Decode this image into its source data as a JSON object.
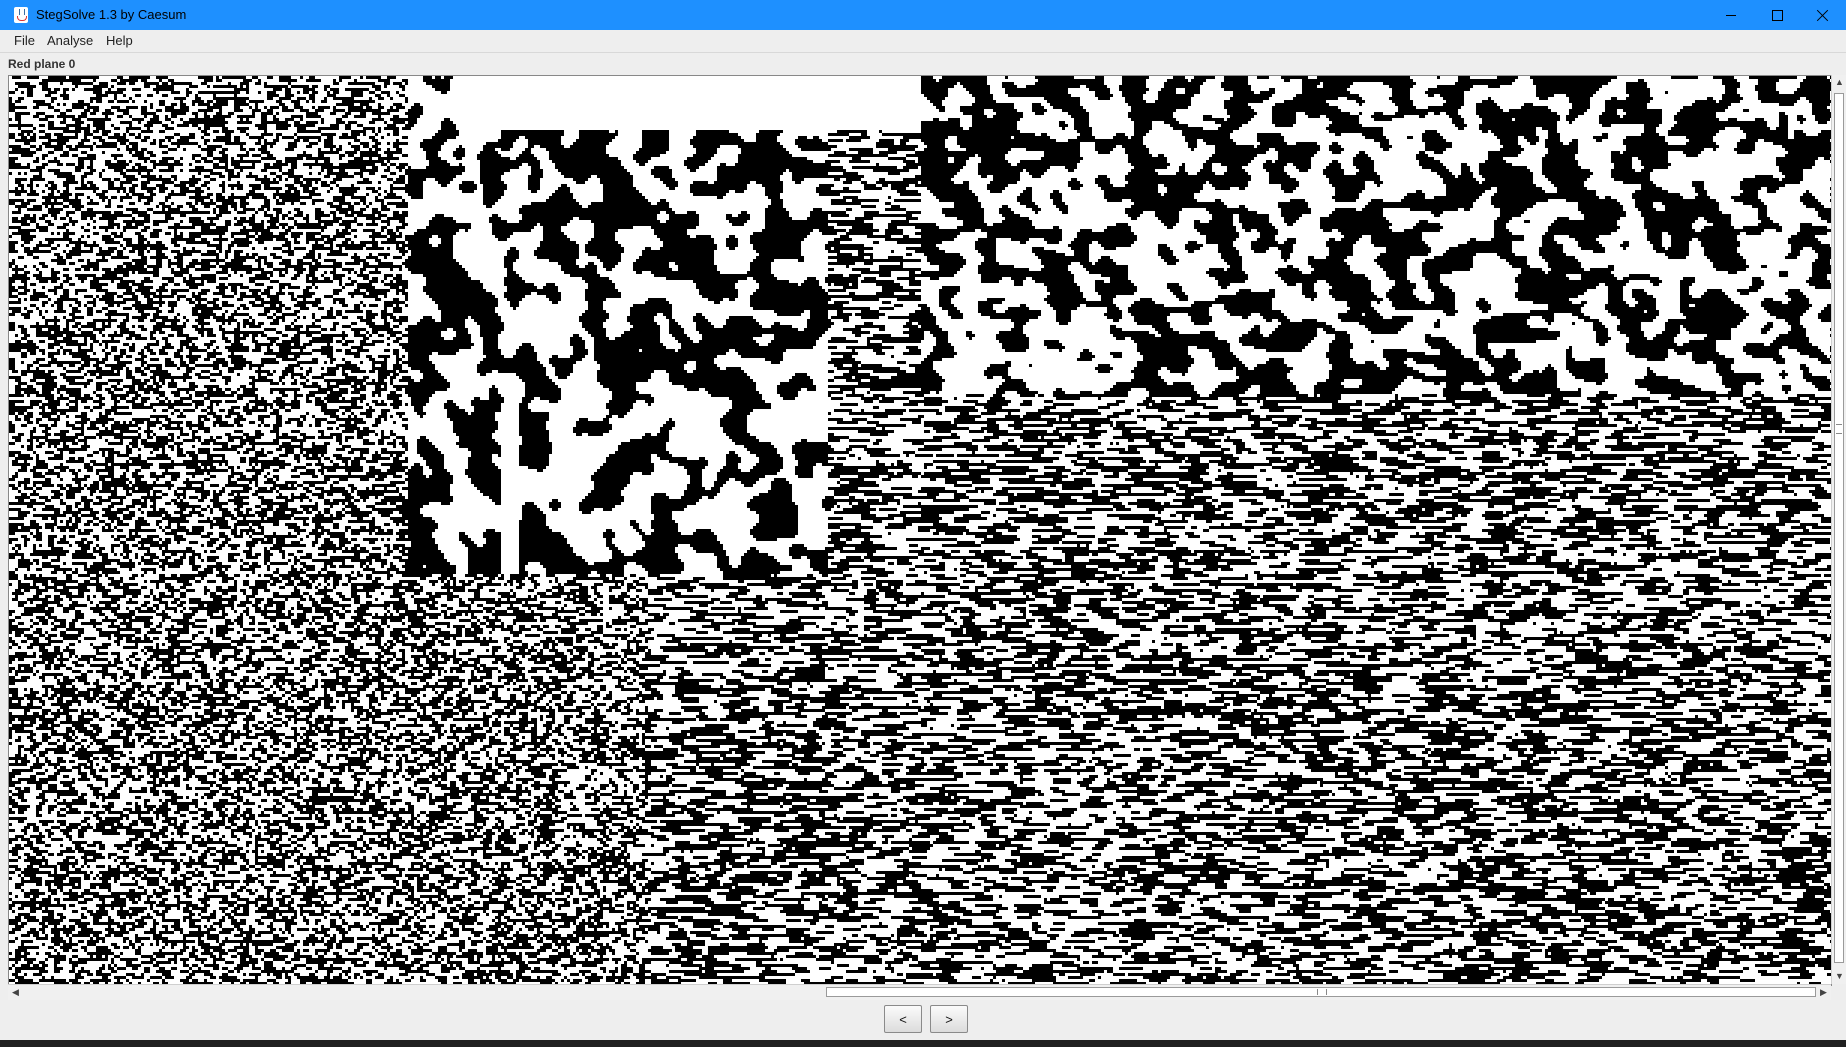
{
  "window": {
    "title": "StegSolve 1.3 by Caesum",
    "icons": {
      "app": "steg-app-icon",
      "minimize": "minimize-icon",
      "maximize": "maximize-icon",
      "close": "close-icon"
    }
  },
  "menu": {
    "items": [
      {
        "label": "File"
      },
      {
        "label": "Analyse"
      },
      {
        "label": "Help"
      }
    ]
  },
  "viewer": {
    "plane_label": "Red plane 0"
  },
  "navigation": {
    "prev_label": "<",
    "next_label": ">"
  },
  "colors": {
    "titlebar": "#1e90ff",
    "pixel_on": "#000000",
    "pixel_off": "#ffffff",
    "window_bg": "#eeeeee"
  }
}
